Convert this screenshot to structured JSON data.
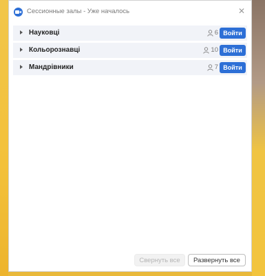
{
  "window": {
    "title": "Сессионные залы - Уже началось",
    "close_glyph": "✕"
  },
  "rooms": [
    {
      "name": "Науковці",
      "participants": "6",
      "join_label": "Войти"
    },
    {
      "name": "Кольорознавці",
      "participants": "10",
      "join_label": "Войти"
    },
    {
      "name": "Мандрівники",
      "participants": "7",
      "join_label": "Войти"
    }
  ],
  "footer": {
    "collapse_all_label": "Свернуть все",
    "expand_all_label": "Развернуть все"
  },
  "colors": {
    "accent": "#2d6fd6",
    "room_row_bg": "#f1f3f8",
    "backdrop": "#f0c240"
  },
  "icons": {
    "app": "zoom-app-icon",
    "close": "close-icon",
    "expand": "chevron-right-icon",
    "participants": "person-icon"
  }
}
